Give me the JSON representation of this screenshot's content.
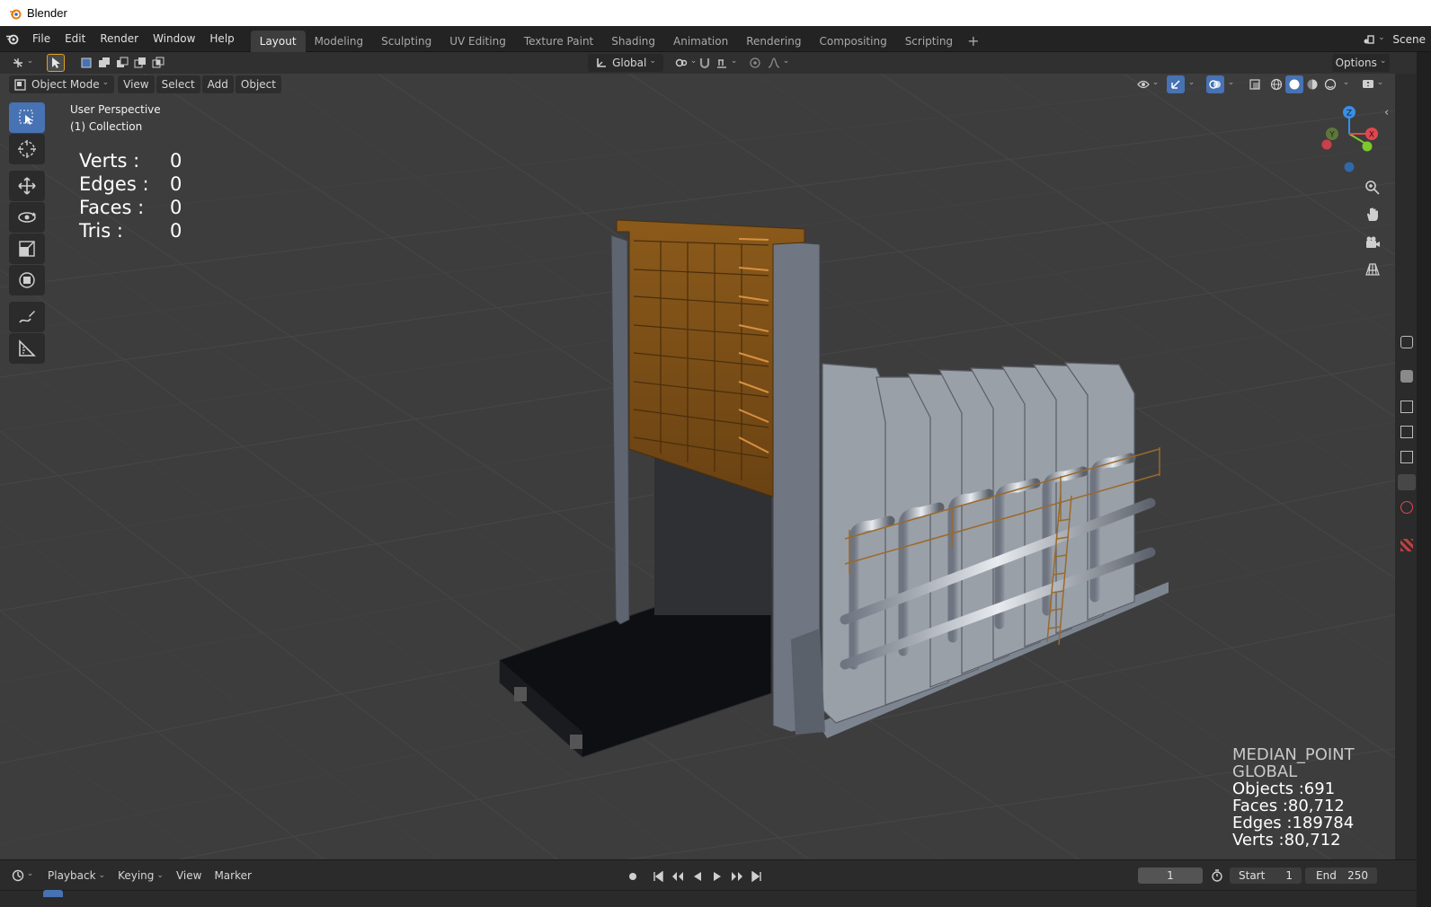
{
  "window": {
    "title": "Blender"
  },
  "menubar": {
    "items": [
      "File",
      "Edit",
      "Render",
      "Window",
      "Help"
    ]
  },
  "workspaces": {
    "tabs": [
      "Layout",
      "Modeling",
      "Sculpting",
      "UV Editing",
      "Texture Paint",
      "Shading",
      "Animation",
      "Rendering",
      "Compositing",
      "Scripting"
    ],
    "active": "Layout",
    "add_symbol": "+"
  },
  "scene": {
    "label": "Scene"
  },
  "tool_header": {
    "orientation": "Global",
    "options_label": "Options"
  },
  "viewport_header": {
    "mode": "Object Mode",
    "menus": [
      "View",
      "Select",
      "Add",
      "Object"
    ]
  },
  "viewport": {
    "view_name": "User Perspective",
    "collection": "(1) Collection",
    "stats_top": {
      "verts_label": "Verts :",
      "verts": "0",
      "edges_label": "Edges :",
      "edges": "0",
      "faces_label": "Faces :",
      "faces": "0",
      "tris_label": "Tris :",
      "tris": "0"
    },
    "stats_bottom": {
      "pivot": "MEDIAN_POINT",
      "orientation": "GLOBAL",
      "objects": "Objects :691",
      "faces": "Faces :80,712",
      "edges": "Edges :189784",
      "verts": "Verts :80,712"
    },
    "gizmo": {
      "x": "X",
      "y": "Y",
      "z": "Z"
    }
  },
  "timeline": {
    "menus": [
      "Playback",
      "Keying",
      "View",
      "Marker"
    ],
    "current_frame": "1",
    "start_label": "Start",
    "start": "1",
    "end_label": "End",
    "end": "250"
  },
  "colors": {
    "accent": "#4772b3",
    "axis_x": "#e0474f",
    "axis_y": "#7dc92b",
    "axis_z": "#3a8ee6",
    "grid_bg": "#3d3d3d"
  }
}
